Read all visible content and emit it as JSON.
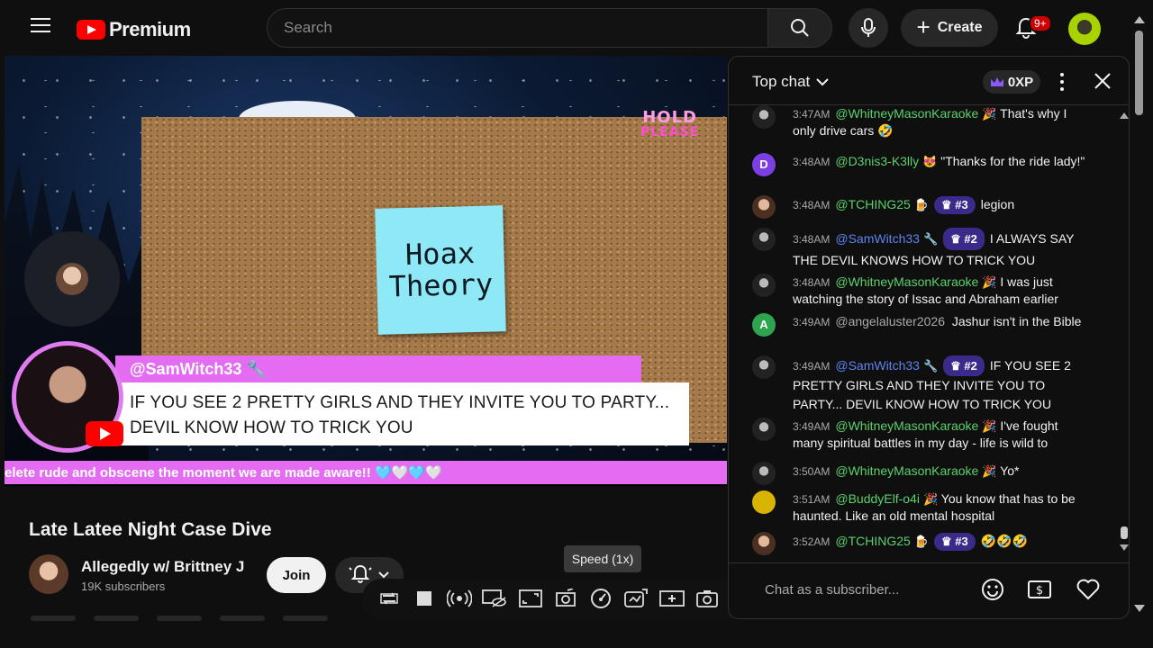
{
  "header": {
    "logo_text": "Premium",
    "search_placeholder": "Search",
    "create_label": "Create",
    "notification_count": "9+"
  },
  "video": {
    "hold_line1": "HOLD",
    "hold_line2": "PLEASE",
    "sticky_line1": "Hoax",
    "sticky_line2": "Theory",
    "overlay_author": "@SamWitch33 🔧",
    "overlay_line1": "IF YOU SEE 2 PRETTY GIRLS AND THEY INVITE YOU TO PARTY...",
    "overlay_line2": "DEVIL KNOW HOW TO TRICK YOU",
    "ticker": "elete rude and obscene the moment we are made aware!! 🩵🤍🩵🤍"
  },
  "details": {
    "title": "Late Latee Night Case Dive",
    "channel_name": "Allegedly w/ Brittney J",
    "subscribers": "19K subscribers",
    "join_label": "Join",
    "speed_tooltip": "Speed (1x)"
  },
  "chat": {
    "mode_label": "Top chat",
    "xp_label": "0XP",
    "input_placeholder": "Chat as a subscriber...",
    "messages": [
      {
        "time": "3:47AM",
        "author": "@WhitneyMasonKaraoke",
        "badge": "",
        "text": "That's why I only drive cars 🤣",
        "emoji": "🎉"
      },
      {
        "time": "3:48AM",
        "author": "@D3nis3-K3lly",
        "badge": "",
        "text": "\"Thanks for the ride lady!\"",
        "emoji": "😻",
        "initial": "D"
      },
      {
        "time": "3:48AM",
        "author": "@TCHING25",
        "badge": "#3",
        "text": "legion",
        "emoji": "🍺"
      },
      {
        "time": "3:48AM",
        "author": "@SamWitch33",
        "badge": "#2",
        "text": "I ALWAYS SAY THE DEVIL KNOWS HOW TO TRICK YOU",
        "emoji": "🔧"
      },
      {
        "time": "3:48AM",
        "author": "@WhitneyMasonKaraoke",
        "badge": "",
        "text": "I was just watching the story of Issac and Abraham earlier",
        "emoji": "🎉"
      },
      {
        "time": "3:49AM",
        "author": "@angelaluster2026",
        "badge": "",
        "text": "Jashur isn't in the Bible",
        "emoji": "",
        "initial": "A"
      },
      {
        "time": "3:49AM",
        "author": "@SamWitch33",
        "badge": "#2",
        "text": "IF YOU SEE 2 PRETTY GIRLS AND THEY INVITE YOU TO PARTY... DEVIL KNOW HOW TO TRICK YOU",
        "emoji": "🔧"
      },
      {
        "time": "3:49AM",
        "author": "@WhitneyMasonKaraoke",
        "badge": "",
        "text": "I've fought many spiritual battles in my day - life is wild to",
        "emoji": "🎉"
      },
      {
        "time": "3:50AM",
        "author": "@WhitneyMasonKaraoke",
        "badge": "",
        "text": "Yo*",
        "emoji": "🎉"
      },
      {
        "time": "3:51AM",
        "author": "@BuddyElf-o4i",
        "badge": "",
        "text": "You know that has to be haunted. Like an old mental hospital",
        "emoji": "🎉"
      },
      {
        "time": "3:52AM",
        "author": "@TCHING25",
        "badge": "#3",
        "text": "🤣🤣🤣",
        "emoji": "🍺"
      }
    ]
  },
  "colors": {
    "accent_pink": "#e36cf2",
    "brand_red": "#ff0000",
    "author_green": "#5ad16b",
    "moderator_blue": "#5e84f1"
  }
}
